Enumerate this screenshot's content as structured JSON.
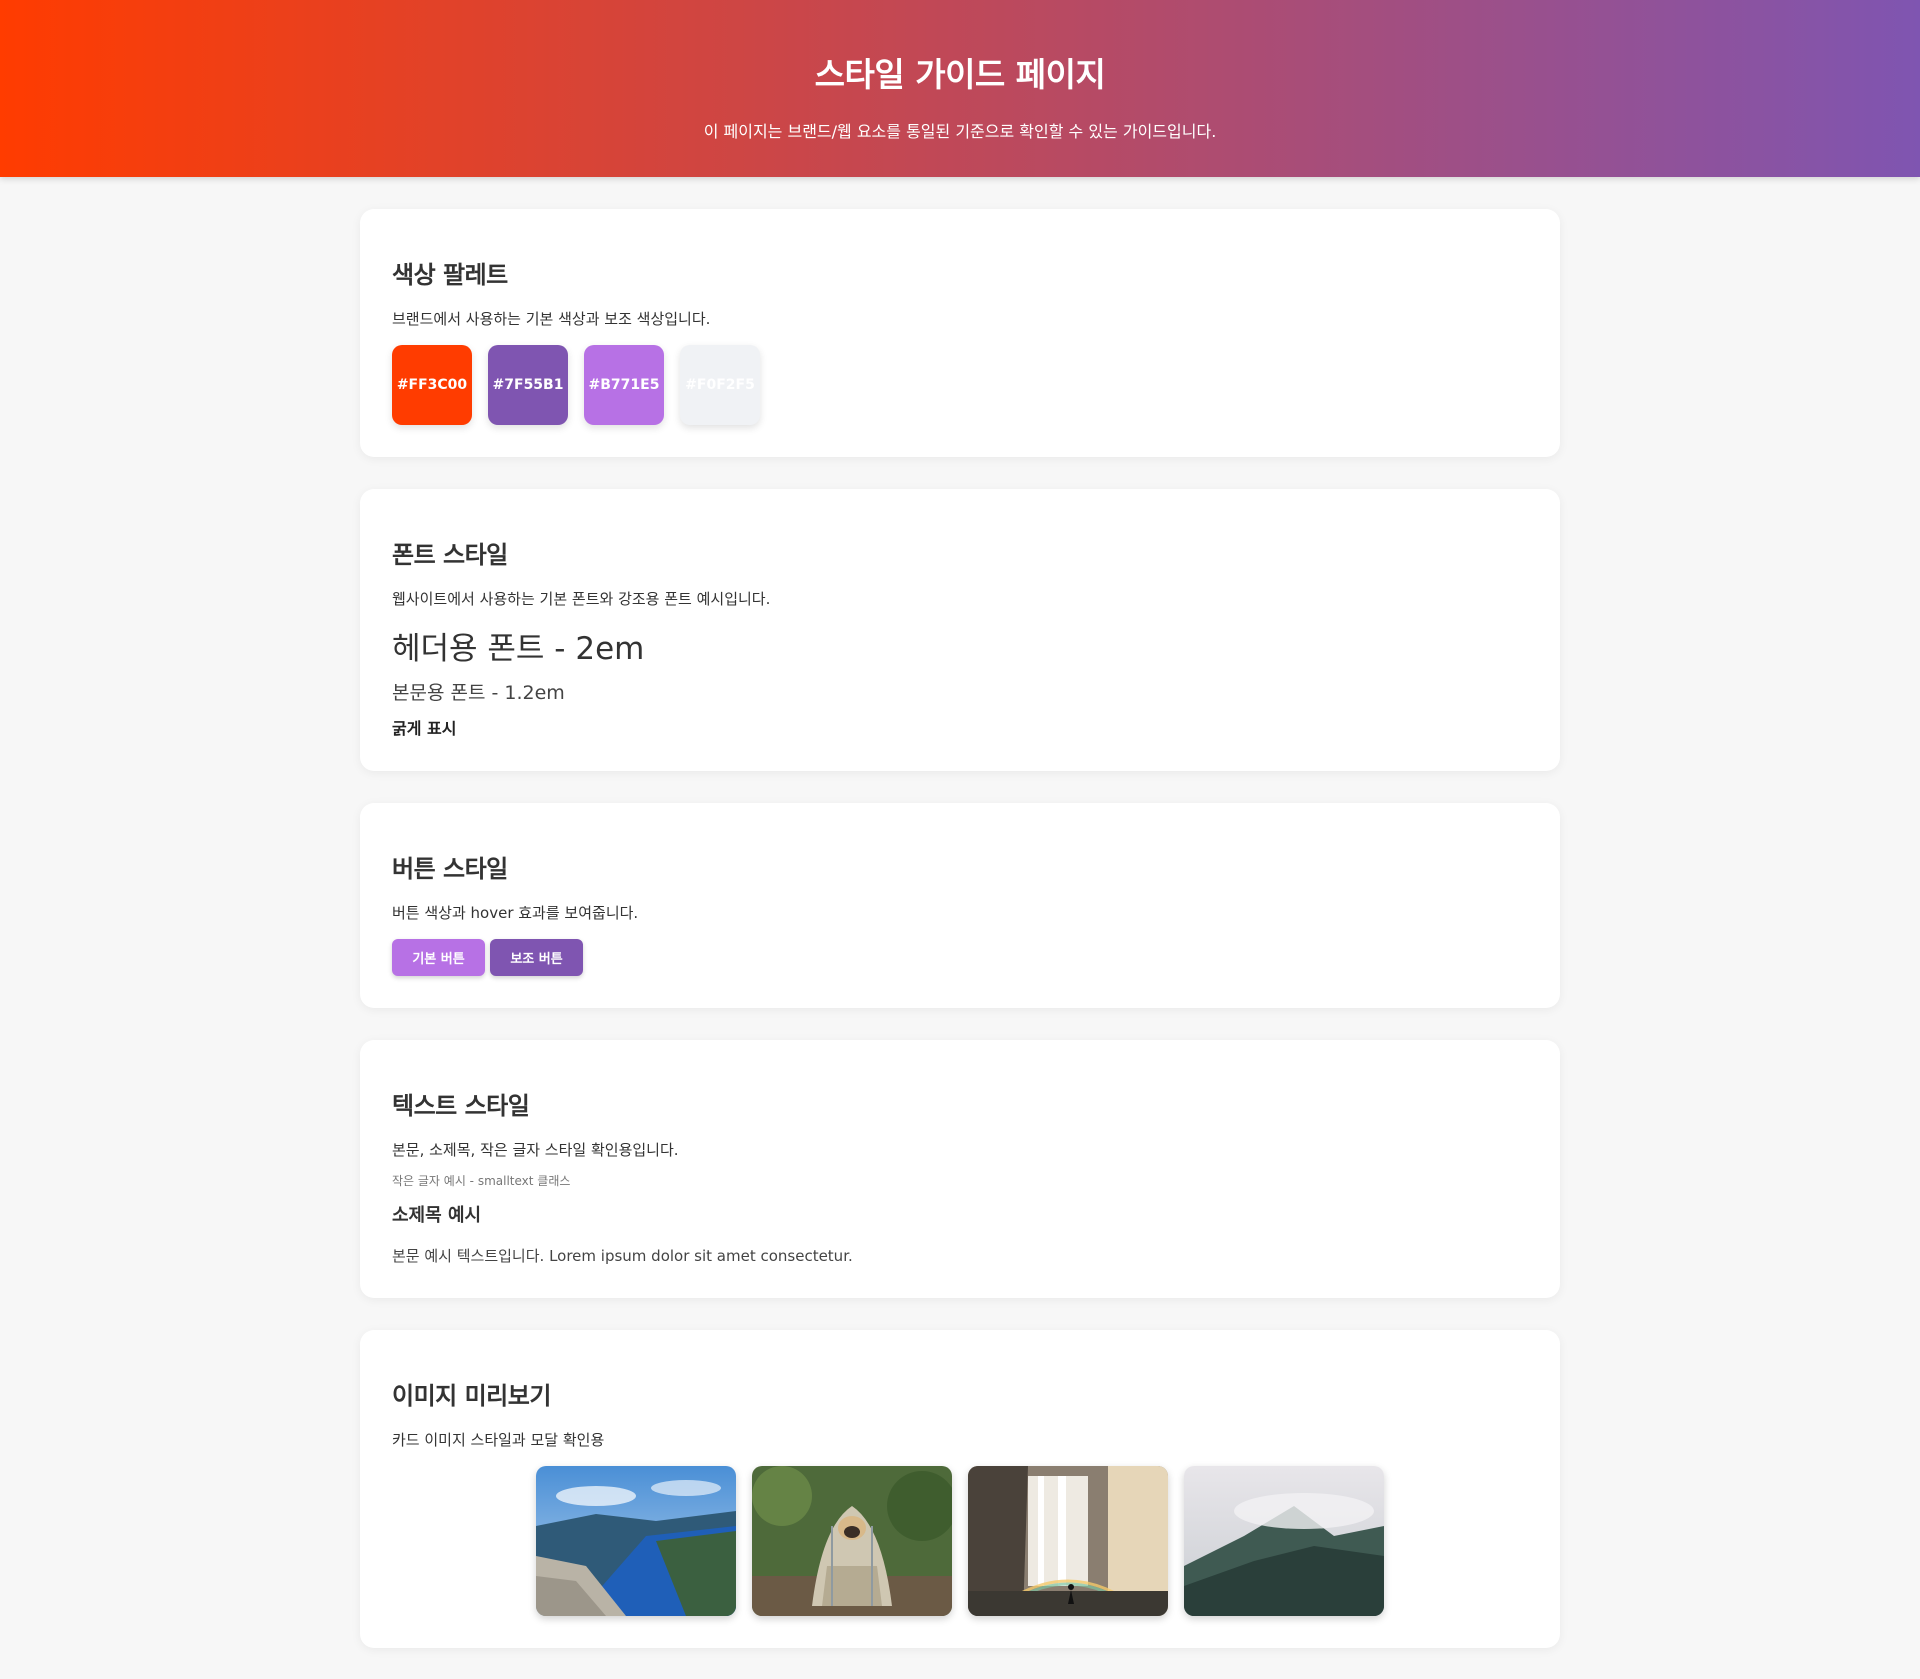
{
  "header": {
    "title": "스타일 가이드 페이지",
    "subtitle": "이 페이지는 브랜드/웹 요소를 통일된 기준으로 확인할 수 있는 가이드입니다."
  },
  "palette": {
    "title": "색상 팔레트",
    "desc": "브랜드에서 사용하는 기본 색상과 보조 색상입니다.",
    "colors": [
      {
        "label": "#FF3C00",
        "hex": "#FF3C00"
      },
      {
        "label": "#7F55B1",
        "hex": "#7F55B1"
      },
      {
        "label": "#B771E5",
        "hex": "#B771E5"
      },
      {
        "label": "#F0F2F5",
        "hex": "#F0F2F5"
      }
    ]
  },
  "fonts": {
    "title": "폰트 스타일",
    "desc": "웹사이트에서 사용하는 기본 폰트와 강조용 폰트 예시입니다.",
    "header_sample": "헤더용 폰트 - 2em",
    "body_sample": "본문용 폰트 - 1.2em",
    "bold_sample": "굵게 표시"
  },
  "buttons": {
    "title": "버튼 스타일",
    "desc": "버튼 색상과 hover 효과를 보여줍니다.",
    "primary_label": "기본 버튼",
    "secondary_label": "보조 버튼",
    "primary_color": "#B771E5",
    "secondary_color": "#7F55B1"
  },
  "text": {
    "title": "텍스트 스타일",
    "desc": "본문, 소제목, 작은 글자 스타일 확인용입니다.",
    "small": "작은 글자 예시 - smalltext 클래스",
    "subheading": "소제목 예시",
    "body": "본문 예시 텍스트입니다. Lorem ipsum dolor sit amet consectetur."
  },
  "images": {
    "title": "이미지 미리보기",
    "desc": "카드 이미지 스타일과 모달 확인용",
    "items": [
      "fjord-landscape-image",
      "pug-in-blanket-image",
      "waterfall-rainbow-image",
      "misty-mountain-image"
    ]
  }
}
